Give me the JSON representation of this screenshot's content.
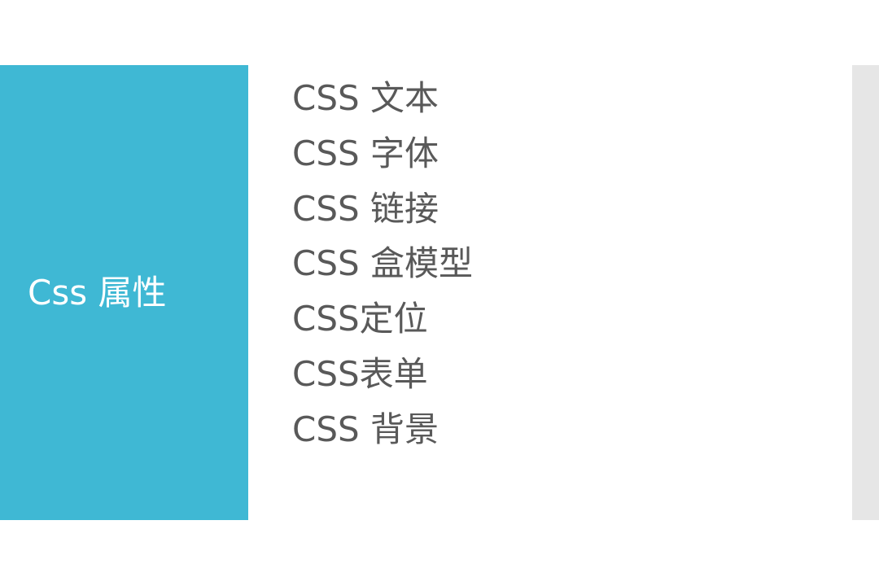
{
  "title_panel": {
    "title": "Css 属性",
    "color": "#3fb8d4"
  },
  "topics": [
    "CSS 文本",
    "CSS 字体",
    "CSS 链接",
    "CSS 盒模型",
    "CSS定位",
    "CSS表单",
    "CSS 背景"
  ],
  "colors": {
    "text": "#595959",
    "strip": "#e6e6e6"
  }
}
